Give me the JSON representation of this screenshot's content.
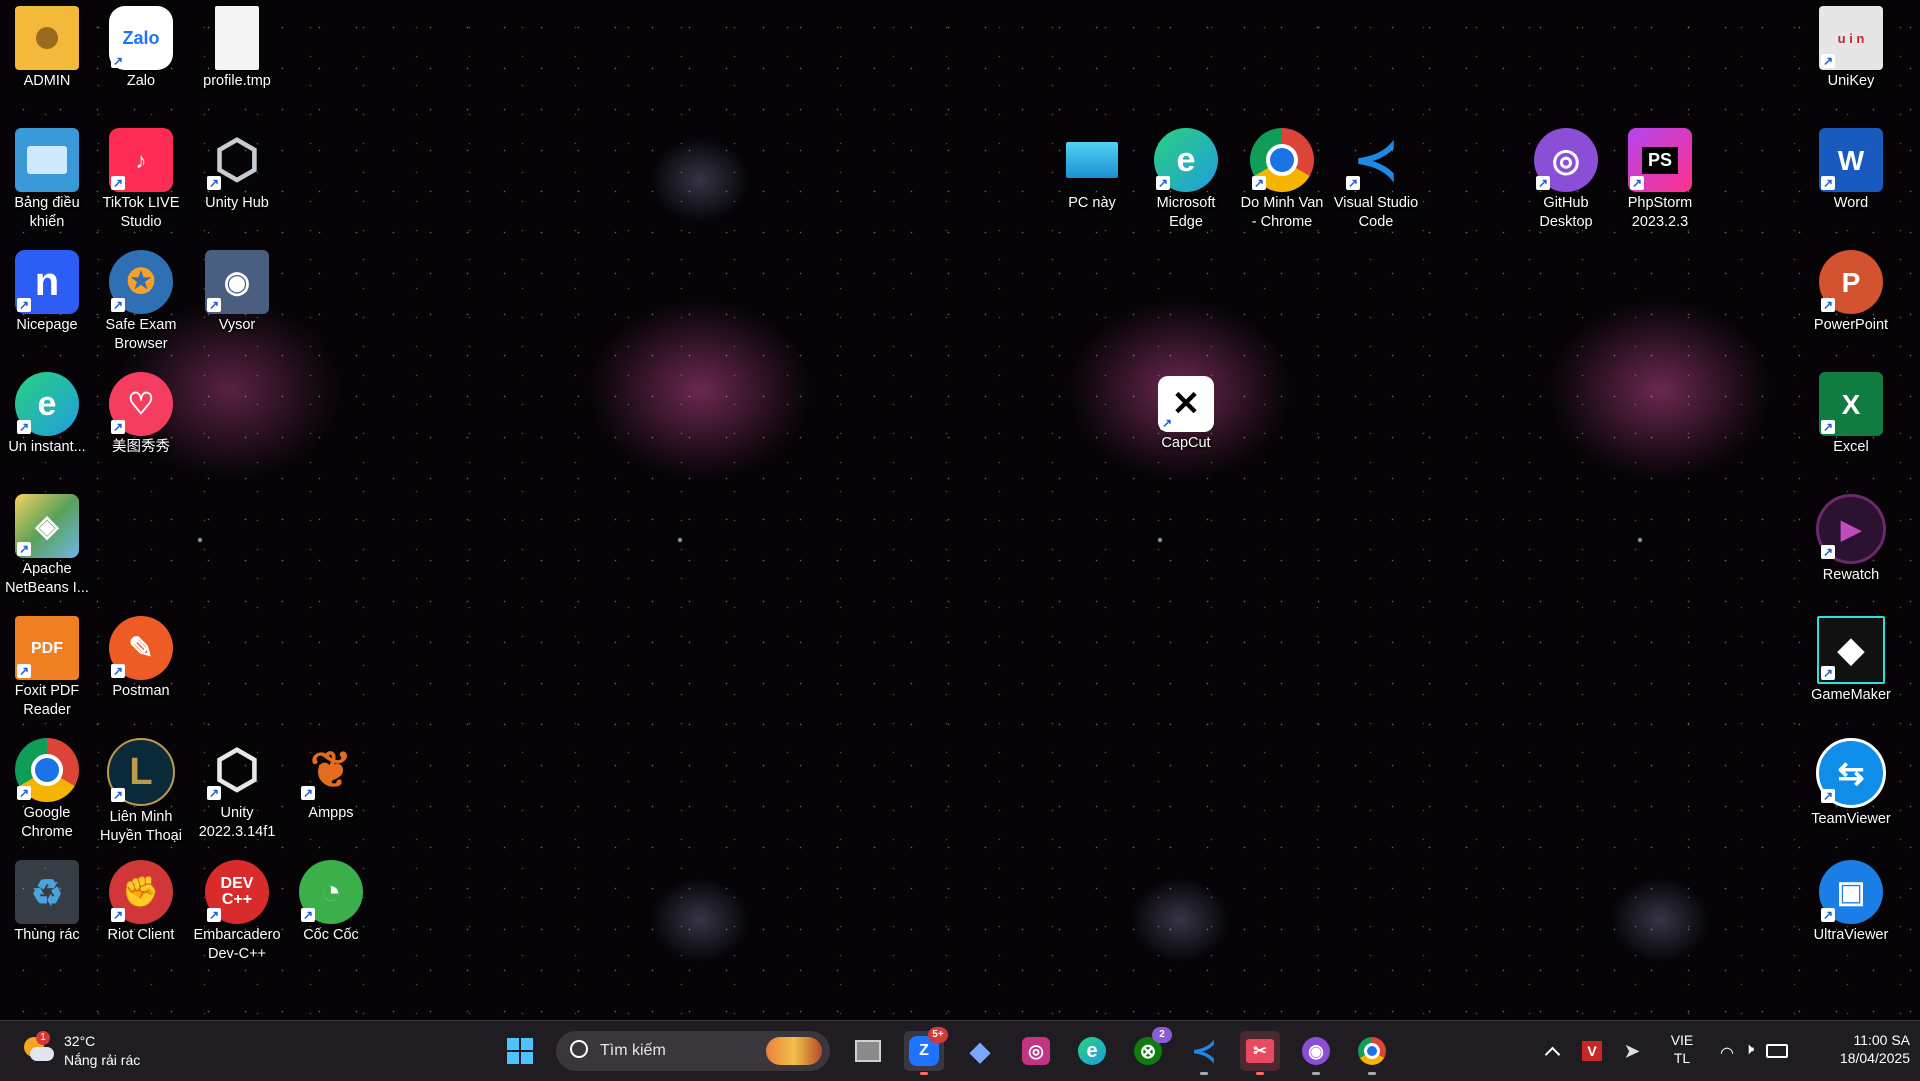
{
  "desktop": {
    "icons": [
      {
        "label": "ADMIN",
        "icon": "user-folder-icon",
        "color": "#f2b93b"
      },
      {
        "label": "Zalo",
        "icon": "zalo-icon",
        "color": "#1f74ff"
      },
      {
        "label": "profile.tmp",
        "icon": "blank-file-icon",
        "color": "#f4f4f4"
      },
      {
        "label": "Bảng điều khiển",
        "icon": "control-panel-icon",
        "color": "#3a9ad9"
      },
      {
        "label": "TikTok LIVE Studio",
        "icon": "tiktok-icon",
        "color": "#fe2c55"
      },
      {
        "label": "Unity Hub",
        "icon": "unity-hub-icon",
        "color": "#8f96a3"
      },
      {
        "label": "Nicepage",
        "icon": "nicepage-icon",
        "color": "#2c5df5"
      },
      {
        "label": "Safe Exam Browser",
        "icon": "safe-exam-icon",
        "color": "#2f6fb4"
      },
      {
        "label": "Vysor",
        "icon": "vysor-icon",
        "color": "#4a5f7f"
      },
      {
        "label": "Un instant...",
        "icon": "edge-icon",
        "color": "#1f9de0"
      },
      {
        "label": "美图秀秀",
        "icon": "meitu-icon",
        "color": "#f43d5f"
      },
      {
        "label": "Apache NetBeans I...",
        "icon": "netbeans-icon",
        "color": "#5aa05a"
      },
      {
        "label": "Foxit PDF Reader",
        "icon": "foxit-icon",
        "color": "#f07f24"
      },
      {
        "label": "Postman",
        "icon": "postman-icon",
        "color": "#ef5b25"
      },
      {
        "label": "Google Chrome",
        "icon": "chrome-icon",
        "color": "#1b73e8"
      },
      {
        "label": "Liên Minh Huyền Thoại",
        "icon": "lol-icon",
        "color": "#c09a4b"
      },
      {
        "label": "Unity 2022.3.14f1",
        "icon": "unity-icon",
        "color": "#333333"
      },
      {
        "label": "Ampps",
        "icon": "ampps-icon",
        "color": "#e36d1d"
      },
      {
        "label": "Thùng rác",
        "icon": "recycle-bin-icon",
        "color": "#4aa3df"
      },
      {
        "label": "Riot Client",
        "icon": "riot-icon",
        "color": "#d13639"
      },
      {
        "label": "Embarcadero Dev-C++",
        "icon": "devcpp-icon",
        "color": "#d92b2b"
      },
      {
        "label": "Cốc Cốc",
        "icon": "coccoc-icon",
        "color": "#3bb04a"
      },
      {
        "label": "PC này",
        "icon": "this-pc-icon",
        "color": "#2cb5e8"
      },
      {
        "label": "Microsoft Edge",
        "icon": "edge-icon",
        "color": "#1f9de0"
      },
      {
        "label": "Do Minh Van - Chrome",
        "icon": "chrome-profile-icon",
        "color": "#1b73e8"
      },
      {
        "label": "Visual Studio Code",
        "icon": "vscode-icon",
        "color": "#1e88e5"
      },
      {
        "label": "GitHub Desktop",
        "icon": "github-icon",
        "color": "#8a4fd6"
      },
      {
        "label": "PhpStorm 2023.2.3",
        "icon": "phpstorm-icon",
        "color": "#b345f1"
      },
      {
        "label": "CapCut",
        "icon": "capcut-icon",
        "color": "#ffffff"
      },
      {
        "label": "UniKey",
        "icon": "unikey-icon",
        "color": "#e6e6e6"
      },
      {
        "label": "Word",
        "icon": "word-icon",
        "color": "#185abd"
      },
      {
        "label": "PowerPoint",
        "icon": "powerpoint-icon",
        "color": "#d35230"
      },
      {
        "label": "Excel",
        "icon": "excel-icon",
        "color": "#107c41"
      },
      {
        "label": "Rewatch",
        "icon": "rewatch-icon",
        "color": "#6a2a6a"
      },
      {
        "label": "GameMaker",
        "icon": "gamemaker-icon",
        "color": "#111111"
      },
      {
        "label": "TeamViewer",
        "icon": "teamviewer-icon",
        "color": "#0e8ee9"
      },
      {
        "label": "UltraViewer",
        "icon": "ultraviewer-icon",
        "color": "#1a7ee6"
      }
    ],
    "glyphs": [
      "",
      "Zalo",
      "",
      "",
      "♪",
      "⬡",
      "n",
      "✪",
      "◉",
      "e",
      "♡",
      "◈",
      "PDF",
      "✎",
      "",
      "L",
      "⬡",
      "❦",
      "♻",
      "✊",
      "DEV C++",
      "◔",
      "▭",
      "e",
      "",
      "≺",
      "◎",
      "PS",
      "✕",
      "u i n",
      "W",
      "P",
      "X",
      "▶",
      "◆",
      "⇆",
      "▣"
    ]
  },
  "taskbar": {
    "weather": {
      "temp": "32°C",
      "desc": "Nắng rải rác",
      "alert": "1"
    },
    "search_placeholder": "Tìm kiếm",
    "apps": [
      {
        "icon": "start-icon",
        "glyph": "",
        "badge": ""
      },
      {
        "icon": "task-view-icon",
        "glyph": "",
        "badge": ""
      },
      {
        "icon": "zalo-taskbar-icon",
        "glyph": "Z",
        "badge": "5+"
      },
      {
        "icon": "copilot-icon",
        "glyph": "◆",
        "badge": ""
      },
      {
        "icon": "messenger-icon",
        "glyph": "◎",
        "badge": ""
      },
      {
        "icon": "edge-taskbar-icon",
        "glyph": "e",
        "badge": ""
      },
      {
        "icon": "xbox-icon",
        "glyph": "⊗",
        "badge": "2"
      },
      {
        "icon": "vscode-taskbar-icon",
        "glyph": "≺",
        "badge": ""
      },
      {
        "icon": "snipping-tool-icon",
        "glyph": "✂",
        "badge": ""
      },
      {
        "icon": "github-taskbar-icon",
        "glyph": "◉",
        "badge": ""
      },
      {
        "icon": "chrome-taskbar-icon",
        "glyph": "",
        "badge": ""
      }
    ],
    "tray": {
      "lang_top": "VIE",
      "lang_bottom": "TL",
      "time": "11:00 SA",
      "date": "18/04/2025"
    }
  }
}
